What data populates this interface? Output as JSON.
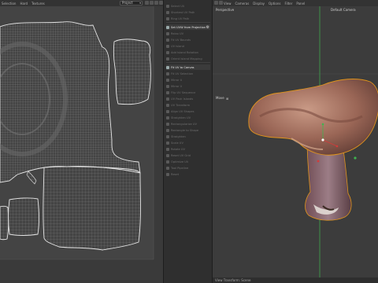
{
  "uv_editor": {
    "menu": [
      "Selection",
      "Hard",
      "Textures"
    ],
    "view_select": "Project"
  },
  "tools_panel": {
    "items": [
      {
        "label": "Select UV",
        "state": "dim"
      },
      {
        "label": "Shortest UV Path",
        "state": "dim"
      },
      {
        "label": "Ring UV Path",
        "state": "dim"
      },
      {
        "label": "Set UVW from Projection",
        "state": "active"
      },
      {
        "label": "Relax UV",
        "state": "dim"
      },
      {
        "label": "Fit UV Bounds",
        "state": "dim"
      },
      {
        "label": "UV Island",
        "state": "dim"
      },
      {
        "label": "Add Island Rotation",
        "state": "dim"
      },
      {
        "label": "Orient Island Mapping",
        "state": "dim"
      },
      {
        "label": "Fit UV to Canvas",
        "state": "active"
      },
      {
        "label": "Fit UV Selection",
        "state": "dim"
      },
      {
        "label": "Mirror U",
        "state": "dim"
      },
      {
        "label": "Mirror V",
        "state": "dim"
      },
      {
        "label": "Flip UV Sequence",
        "state": "dim"
      },
      {
        "label": "UV Pack Islands",
        "state": "dim"
      },
      {
        "label": "UV Transform",
        "state": "dim"
      },
      {
        "label": "Align UV Shapes",
        "state": "dim"
      },
      {
        "label": "Straighten UV",
        "state": "dim"
      },
      {
        "label": "Rectangularize UV",
        "state": "dim"
      },
      {
        "label": "Rectangle to Shape",
        "state": "dim"
      },
      {
        "label": "Straighten",
        "state": "dim"
      },
      {
        "label": "Scale UV",
        "state": "dim"
      },
      {
        "label": "Rotate UV",
        "state": "dim"
      },
      {
        "label": "Reset UV Grid",
        "state": "dim"
      },
      {
        "label": "Optimize UV",
        "state": "dim"
      },
      {
        "label": "Tool Pipeline",
        "state": "dim"
      },
      {
        "label": "Reset",
        "state": "dim"
      }
    ]
  },
  "viewport": {
    "menu": [
      "View",
      "Cameras",
      "Display",
      "Options",
      "Filter",
      "Panel"
    ],
    "mode_label": "Perspective",
    "camera_label": "Default Camera",
    "move_label": "Move",
    "footer": "View Transform: Scene"
  },
  "colors": {
    "uv_wire": "#8a8a8a",
    "uv_border": "#e6e6e6",
    "axis_y": "#3fb34f",
    "axis_x": "#d23b3b",
    "selection_outline": "#e0941c"
  }
}
